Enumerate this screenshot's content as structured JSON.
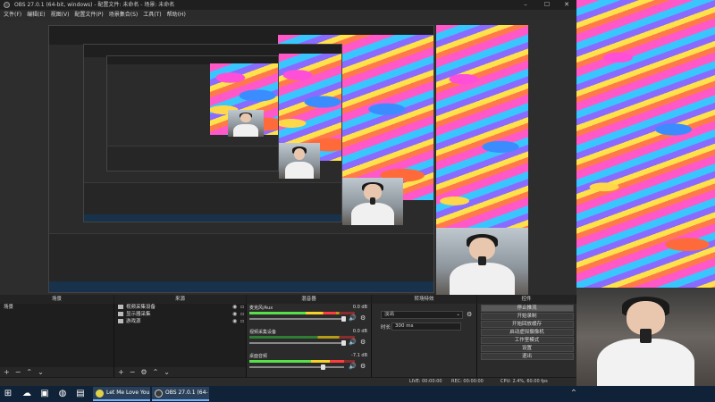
{
  "window": {
    "title": "OBS 27.0.1 (64-bit, windows) - 配置文件: 未命名 - 场景: 未命名"
  },
  "menu": [
    "文件(F)",
    "编辑(E)",
    "视图(V)",
    "配置文件(P)",
    "场景集合(S)",
    "工具(T)",
    "帮助(H)"
  ],
  "docks": {
    "scenes": {
      "title": "场景",
      "items": [
        "场景"
      ]
    },
    "sources": {
      "title": "来源",
      "items": [
        "视频采集设备",
        "显示器采集",
        "游戏源"
      ]
    },
    "mixer": {
      "title": "混音器",
      "tracks": [
        {
          "name": "麦克风/Aux",
          "db": "0.0 dB",
          "level": 0.82,
          "fader": 0.97
        },
        {
          "name": "视频采集设备",
          "db": "0.0 dB",
          "level": 0.0,
          "fader": 0.97
        },
        {
          "name": "桌面音频",
          "db": "-7.1 dB",
          "level": 0.9,
          "fader": 0.75
        }
      ]
    },
    "transitions": {
      "title": "转场特效",
      "type": "淡出",
      "duration_label": "时长",
      "duration": "300 ms"
    },
    "controls": {
      "title": "控件",
      "buttons": [
        "停止推流",
        "开始录制",
        "开始回放缓存",
        "启动虚拟摄像机",
        "工作室模式",
        "设置",
        "退出"
      ]
    }
  },
  "active_tab": "来源",
  "status": {
    "dropped": "LIVE: 00:00:00",
    "rec": "REC: 00:00:00",
    "cpu": "CPU: 2.4%, 60.00 fps",
    "kbps": "kb/s"
  },
  "taskbar": {
    "apps": [
      {
        "label": "Let Me Love You ...",
        "color": "#e0d14a"
      },
      {
        "label": "OBS 27.0.1 (64-bi...",
        "color": "#3a3a3a"
      }
    ]
  }
}
